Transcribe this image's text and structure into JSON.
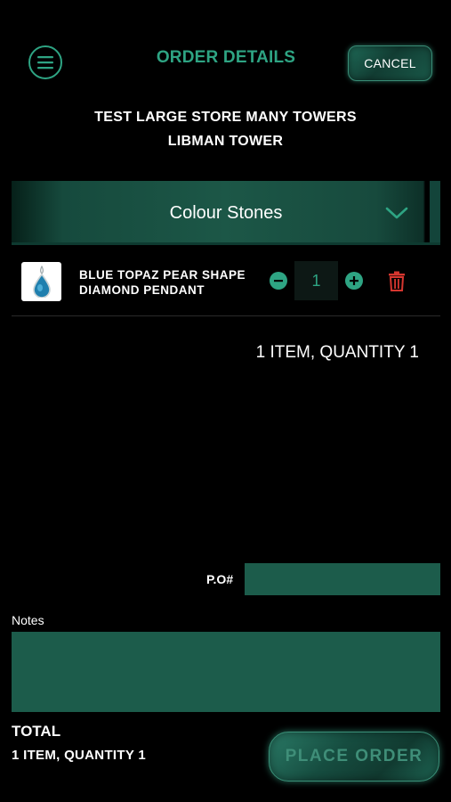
{
  "header": {
    "title": "ORDER DETAILS",
    "cancel_label": "CANCEL"
  },
  "store": {
    "name": "TEST LARGE STORE MANY TOWERS",
    "tower": "LIBMAN TOWER"
  },
  "category": {
    "selected": "Colour Stones"
  },
  "items": [
    {
      "name_line1": "BLUE TOPAZ PEAR SHAPE",
      "name_line2": "DIAMOND PENDANT",
      "quantity": "1",
      "thumbnail_icon": "pendant-image"
    }
  ],
  "summary": {
    "items_text": "1 ITEM, QUANTITY 1"
  },
  "po": {
    "label": "P.O#",
    "value": ""
  },
  "notes": {
    "label": "Notes",
    "value": ""
  },
  "total": {
    "label": "TOTAL",
    "summary": "1 ITEM, QUANTITY 1"
  },
  "actions": {
    "place_order_label": "PLACE ORDER"
  },
  "colors": {
    "accent": "#2ea483",
    "field_bg": "#1c5c4b",
    "delete": "#d6362f"
  }
}
